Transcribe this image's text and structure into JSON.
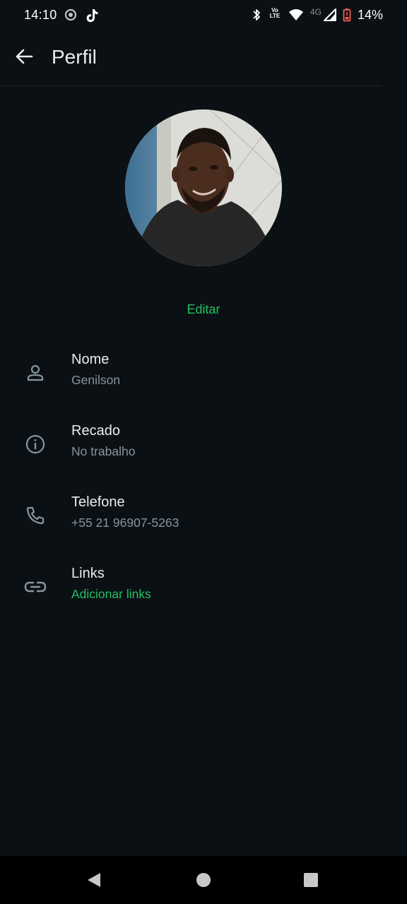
{
  "status_bar": {
    "time": "14:10",
    "network_volte_top": "Vo",
    "network_volte_bottom": "LTE",
    "network_type": "4G",
    "battery_percent": "14%",
    "icons": [
      "camera-dot-icon",
      "tiktok-icon",
      "bluetooth-icon",
      "volte-icon",
      "wifi-icon",
      "signal-icon",
      "battery-icon"
    ]
  },
  "header": {
    "title": "Perfil",
    "back_icon": "arrow-left-icon"
  },
  "profile": {
    "edit_label": "Editar"
  },
  "fields": [
    {
      "label": "Nome",
      "value": "Genilson",
      "icon": "person-icon"
    },
    {
      "label": "Recado",
      "value": "No trabalho",
      "icon": "info-icon"
    },
    {
      "label": "Telefone",
      "value": "+55 21 96907-5263",
      "icon": "phone-icon"
    },
    {
      "label": "Links",
      "value": "Adicionar links",
      "icon": "link-icon"
    }
  ],
  "colors": {
    "background": "#0b1014",
    "accent": "#21c063",
    "primary_text": "#e9edef",
    "secondary_text": "#8696a0",
    "battery_low": "#f15c4d"
  },
  "nav": {
    "icons": [
      "back-triangle-icon",
      "home-circle-icon",
      "recents-square-icon"
    ]
  }
}
